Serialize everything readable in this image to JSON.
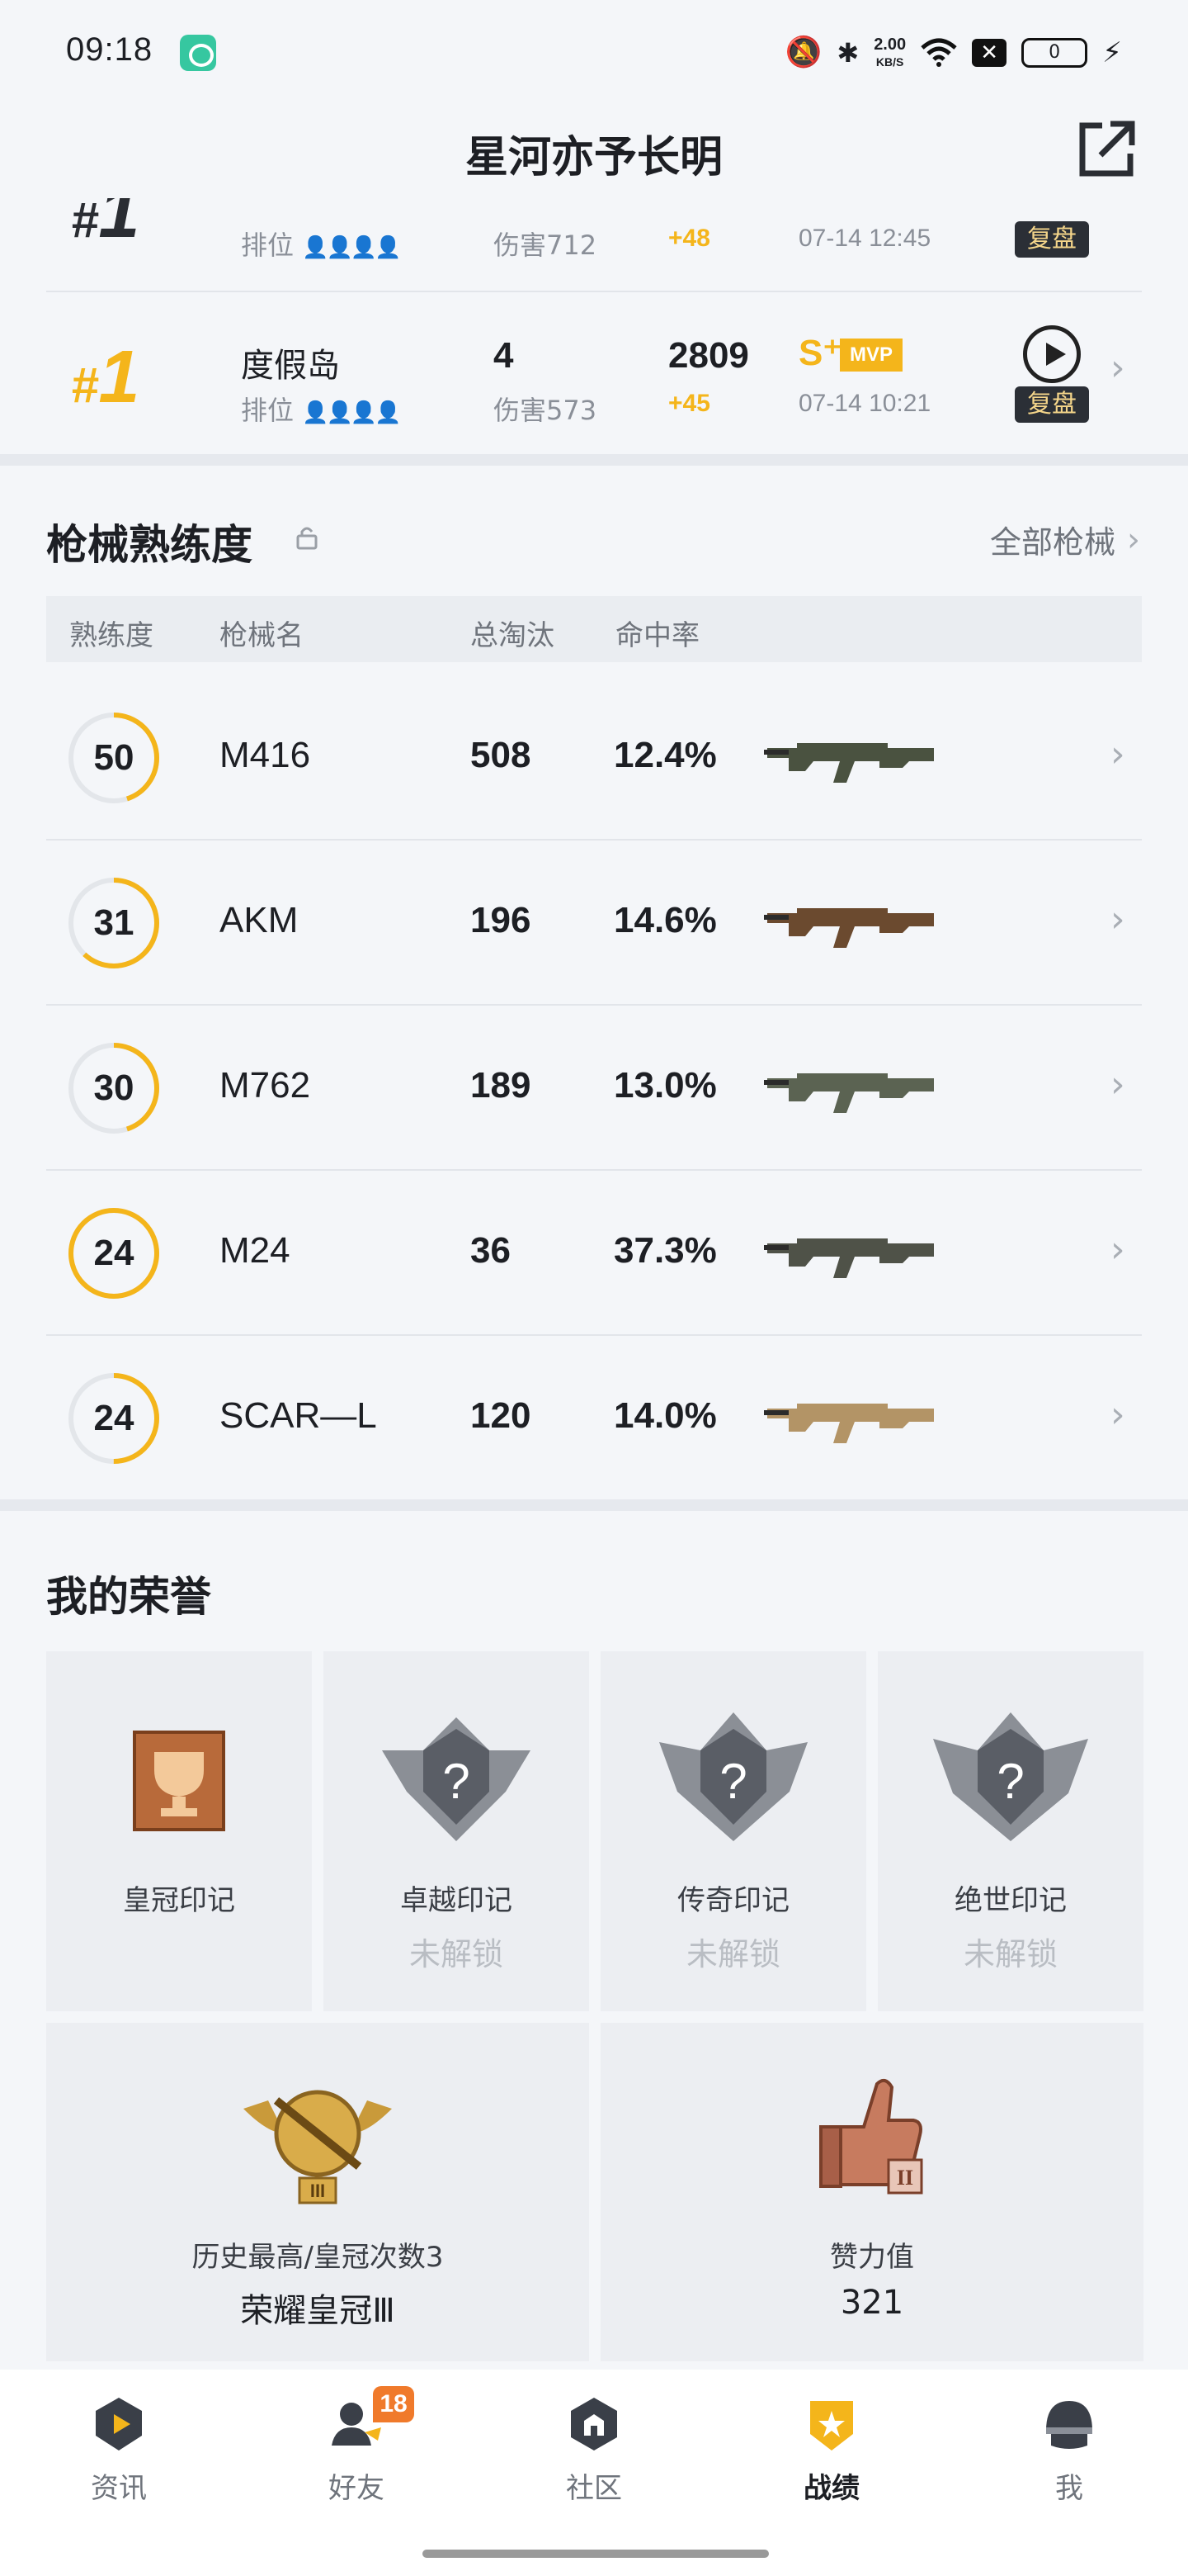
{
  "status_bar": {
    "time": "09:18",
    "network_speed_value": "2.00",
    "network_speed_unit": "KB/S",
    "battery": "0"
  },
  "header": {
    "title": "星河亦予长明"
  },
  "matches": [
    {
      "rank": "1",
      "map": "",
      "mode": "排位",
      "kills": "",
      "damage": "伤害712",
      "score": "",
      "delta": "+48",
      "time": "07-14 12:45",
      "replay_label": "复盘"
    },
    {
      "rank": "1",
      "map": "度假岛",
      "mode": "排位",
      "kills": "4",
      "damage": "伤害573",
      "score": "2809",
      "delta": "+45",
      "grade": "S⁺",
      "mvp": "MVP",
      "time": "07-14 10:21",
      "replay_label": "复盘"
    }
  ],
  "weapons": {
    "title": "枪械熟练度",
    "all_link": "全部枪械",
    "headers": {
      "proficiency": "熟练度",
      "name": "枪械名",
      "kills": "总淘汰",
      "accuracy": "命中率"
    },
    "rows": [
      {
        "level": "50",
        "name": "M416",
        "kills": "508",
        "accuracy": "12.4%",
        "progress": 0.45
      },
      {
        "level": "31",
        "name": "AKM",
        "kills": "196",
        "accuracy": "14.6%",
        "progress": 0.62
      },
      {
        "level": "30",
        "name": "M762",
        "kills": "189",
        "accuracy": "13.0%",
        "progress": 0.45
      },
      {
        "level": "24",
        "name": "M24",
        "kills": "36",
        "accuracy": "37.3%",
        "progress": 1.0
      },
      {
        "level": "24",
        "name": "SCAR—L",
        "kills": "120",
        "accuracy": "14.0%",
        "progress": 0.5
      }
    ]
  },
  "honors": {
    "title": "我的荣誉",
    "marks": [
      {
        "label": "皇冠印记",
        "status": ""
      },
      {
        "label": "卓越印记",
        "status": "未解锁"
      },
      {
        "label": "传奇印记",
        "status": "未解锁"
      },
      {
        "label": "绝世印记",
        "status": "未解锁"
      }
    ],
    "highest": {
      "caption": "历史最高/皇冠次数3",
      "value": "荣耀皇冠Ⅲ"
    },
    "likes": {
      "caption": "赞力值",
      "value": "321"
    }
  },
  "nav": {
    "items": [
      {
        "label": "资讯"
      },
      {
        "label": "好友",
        "badge": "18"
      },
      {
        "label": "社区"
      },
      {
        "label": "战绩"
      },
      {
        "label": "我"
      }
    ]
  },
  "colors": {
    "accent": "#f4b51b",
    "background": "#f4f6f9",
    "badge": "#f07a2b"
  }
}
